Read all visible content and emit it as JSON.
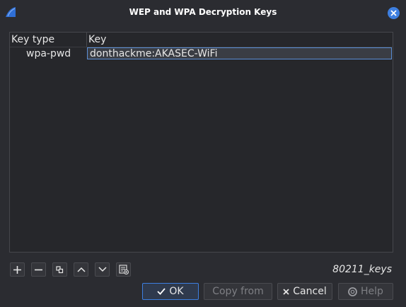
{
  "window": {
    "title": "WEP and WPA Decryption Keys",
    "app_icon": "wireshark-fin-icon",
    "close_icon": "close-icon"
  },
  "table": {
    "columns": [
      "Key type",
      "Key"
    ],
    "rows": [
      {
        "type": "wpa-pwd",
        "key": "donthackme:AKASEC-WiFi"
      }
    ]
  },
  "toolbar": {
    "icons": [
      "add-icon",
      "remove-icon",
      "copy-icon",
      "move-up-icon",
      "move-down-icon",
      "clear-icon"
    ]
  },
  "filename": "80211_keys",
  "buttons": {
    "ok": "OK",
    "copy_from": "Copy from",
    "cancel": "Cancel",
    "help": "Help"
  },
  "colors": {
    "accent": "#3d7fe0",
    "background": "#2b2c31"
  }
}
